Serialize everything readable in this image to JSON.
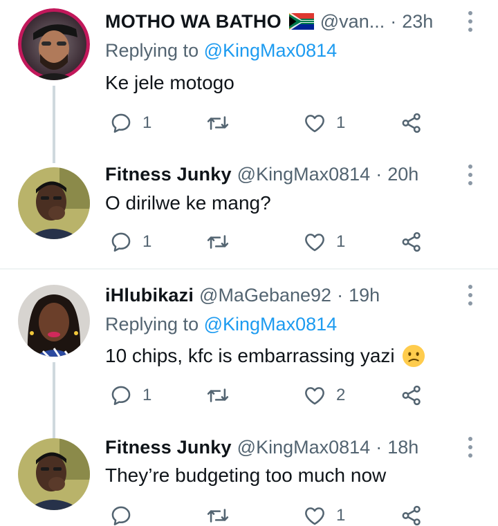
{
  "tweets": [
    {
      "name": "MOTHO WA BATHO",
      "flag": "south-africa-flag",
      "handle": "@van...",
      "separator": "·",
      "time": "23h",
      "replying_prefix": "Replying to",
      "replying_to": "@KingMax0814",
      "text": "Ke jele motogo",
      "replies": "1",
      "retweets": "",
      "likes": "1"
    },
    {
      "name": "Fitness Junky",
      "handle": "@KingMax0814",
      "separator": "·",
      "time": "20h",
      "text": "O dirilwe ke mang?",
      "replies": "1",
      "retweets": "",
      "likes": "1"
    },
    {
      "name": "iHlubikazi",
      "handle": "@MaGebane92",
      "separator": "·",
      "time": "19h",
      "replying_prefix": "Replying to",
      "replying_to": "@KingMax0814",
      "text": "10 chips, kfc is embarrassing yazi",
      "emoji": "confused-face-emoji",
      "replies": "1",
      "retweets": "",
      "likes": "2"
    },
    {
      "name": "Fitness Junky",
      "handle": "@KingMax0814",
      "separator": "·",
      "time": "18h",
      "text": "They’re budgeting too much now",
      "replies": "",
      "retweets": "",
      "likes": "1"
    }
  ],
  "colors": {
    "link": "#1d9bf0",
    "secondary_text": "#536471",
    "thread_line": "#cfd9de"
  },
  "icons": {
    "reply": "reply-icon",
    "retweet": "retweet-icon",
    "like": "like-icon",
    "share": "share-icon",
    "more": "more-options-icon"
  }
}
